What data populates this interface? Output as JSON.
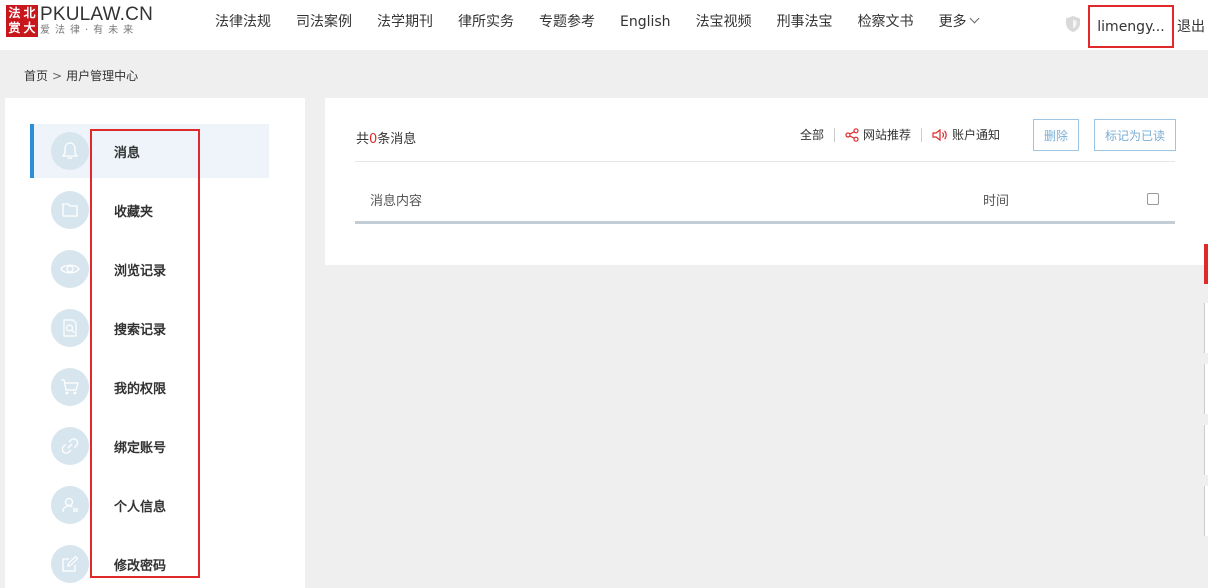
{
  "header": {
    "logo_seal_chars": [
      "法",
      "北",
      "赏",
      "大"
    ],
    "logo_main": "PKULAW.CN",
    "logo_sub": "爱法律·有未来",
    "nav": [
      {
        "label": "法律法规"
      },
      {
        "label": "司法案例"
      },
      {
        "label": "法学期刊"
      },
      {
        "label": "律所实务"
      },
      {
        "label": "专题参考"
      },
      {
        "label": "English"
      },
      {
        "label": "法宝视频"
      },
      {
        "label": "刑事法宝"
      },
      {
        "label": "检察文书"
      },
      {
        "label": "更多"
      }
    ],
    "username": "limengy...",
    "logout": "退出"
  },
  "breadcrumb": {
    "home": "首页",
    "separator": ">",
    "current": "用户管理中心"
  },
  "sidebar": {
    "items": [
      {
        "label": "消息",
        "icon": "bell-icon",
        "active": true
      },
      {
        "label": "收藏夹",
        "icon": "folder-icon",
        "active": false
      },
      {
        "label": "浏览记录",
        "icon": "eye-icon",
        "active": false
      },
      {
        "label": "搜索记录",
        "icon": "search-document-icon",
        "active": false
      },
      {
        "label": "我的权限",
        "icon": "cart-icon",
        "active": false
      },
      {
        "label": "绑定账号",
        "icon": "link-icon",
        "active": false
      },
      {
        "label": "个人信息",
        "icon": "user-profile-icon",
        "active": false
      },
      {
        "label": "修改密码",
        "icon": "edit-icon",
        "active": false
      }
    ]
  },
  "messages": {
    "count_prefix": "共",
    "count": "0",
    "count_suffix": "条消息",
    "filters": {
      "all": "全部",
      "site_recommend": "网站推荐",
      "account_notice": "账户通知"
    },
    "delete_button": "删除",
    "mark_read_button": "标记为已读",
    "columns": {
      "content": "消息内容",
      "time": "时间"
    },
    "rows": []
  },
  "colors": {
    "accent": "#2a8fd6",
    "brand_red": "#c8161d",
    "highlight_red": "#e0292b",
    "icon_circle": "#d6e5ee"
  }
}
